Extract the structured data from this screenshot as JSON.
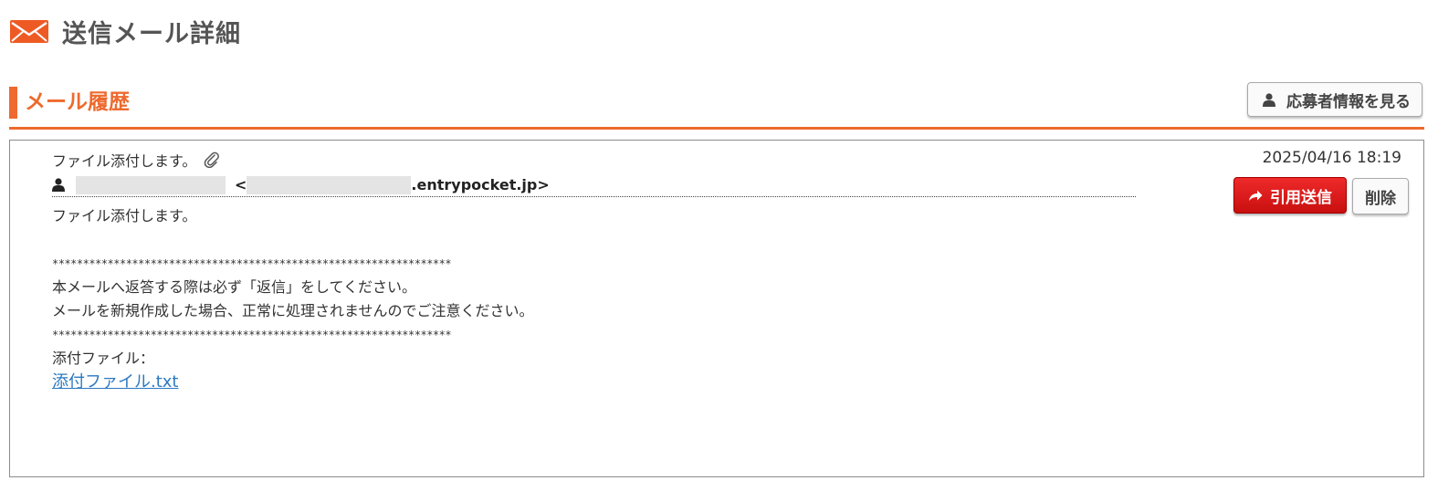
{
  "page": {
    "title": "送信メール詳細"
  },
  "section": {
    "title": "メール履歴",
    "applicant_button_label": "応募者情報を見る"
  },
  "mail": {
    "subject": "ファイル添付します。",
    "date": "2025/04/16 18:19",
    "from_open": "<",
    "from_domain": ".entrypocket.jp>",
    "reply_button_label": "引用送信",
    "delete_button_label": "削除",
    "body_lines": [
      "ファイル添付します。",
      "",
      "*****************************************************************",
      "本メールへ返答する際は必ず「返信」をしてください。",
      "メールを新規作成した場合、正常に処理されませんのでご注意ください。",
      "*****************************************************************",
      "添付ファイル："
    ],
    "attachment_link": "添付ファイル.txt"
  },
  "colors": {
    "accent": "#ee6a2e",
    "reply_button": "#e01b1b",
    "link": "#2b79c2"
  },
  "icons": [
    "envelope-icon",
    "user-icon",
    "paperclip-icon",
    "reply-arrow-icon"
  ]
}
